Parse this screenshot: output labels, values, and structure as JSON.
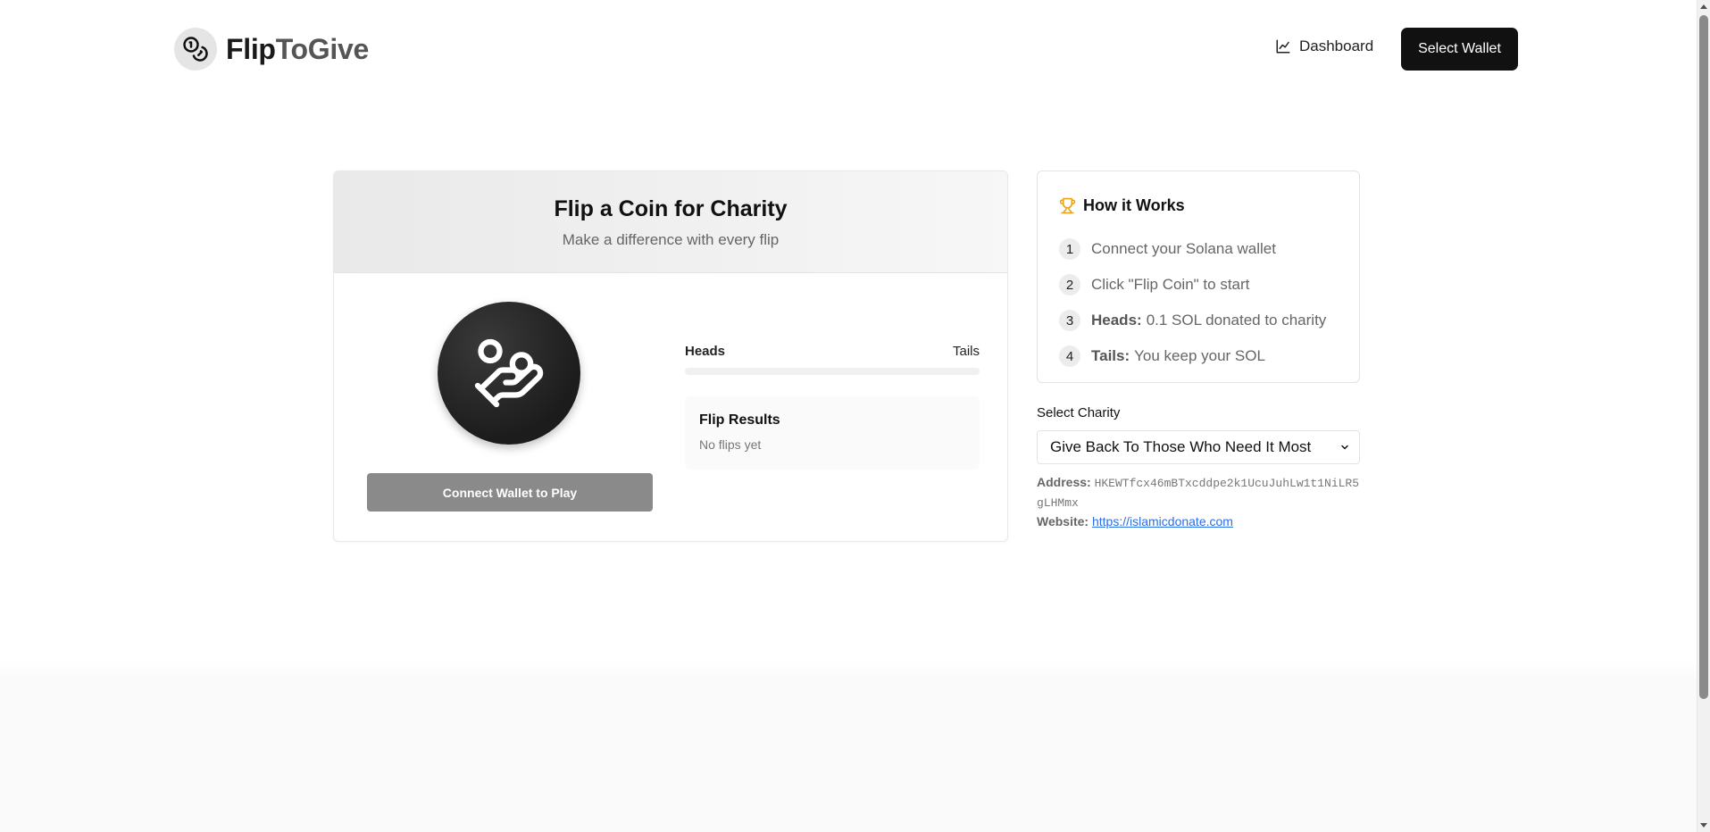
{
  "header": {
    "brand_prefix": "Flip",
    "brand_suffix": "ToGive",
    "dashboard_label": "Dashboard",
    "wallet_button": "Select Wallet"
  },
  "game": {
    "title": "Flip a Coin for Charity",
    "subtitle": "Make a difference with every flip",
    "heads_label": "Heads",
    "tails_label": "Tails",
    "heads_ratio": 0,
    "results_title": "Flip Results",
    "results_empty": "No flips yet",
    "play_button": "Connect Wallet to Play"
  },
  "how": {
    "title": "How it Works",
    "steps": [
      {
        "num": "1",
        "bold": "",
        "text": "Connect your Solana wallet"
      },
      {
        "num": "2",
        "bold": "",
        "text": "Click \"Flip Coin\" to start"
      },
      {
        "num": "3",
        "bold": "Heads:",
        "text": "0.1 SOL donated to charity"
      },
      {
        "num": "4",
        "bold": "Tails:",
        "text": "You keep your SOL"
      }
    ]
  },
  "charity": {
    "label": "Select Charity",
    "selected": "Give Back To Those Who Need It Most",
    "address_label": "Address:",
    "address": "HKEWTfcx46mBTxcddpe2k1UcuJuhLw1t1NiLR5gLHMmx",
    "website_label": "Website:",
    "website": "https://islamicdonate.com"
  },
  "colors": {
    "accent": "#111111",
    "trophy": "#e8a317",
    "link": "#2a6ee8"
  },
  "icons": {
    "logo": "coins-icon",
    "dashboard": "chart-line-icon",
    "how": "trophy-icon",
    "coin": "heart-coin-icon",
    "select": "chevron-down-icon"
  }
}
